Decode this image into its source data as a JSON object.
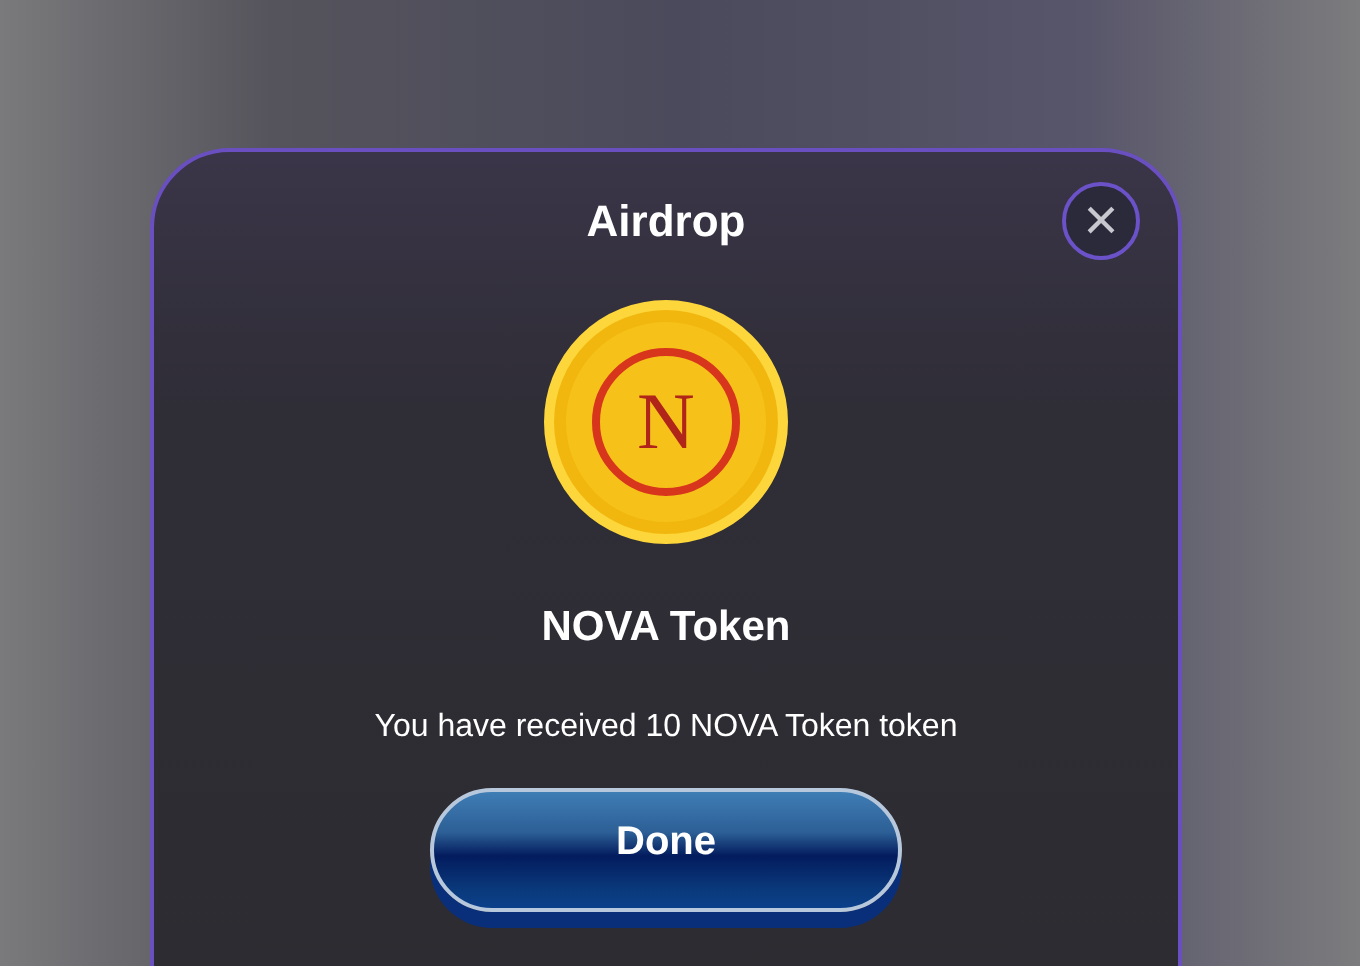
{
  "dialog": {
    "title": "Airdrop",
    "close": "×"
  },
  "token": {
    "logo_letter": "N",
    "name": "NOVA Token"
  },
  "message": "You have received 10 NOVA Token token",
  "buttons": [
    "Done"
  ]
}
